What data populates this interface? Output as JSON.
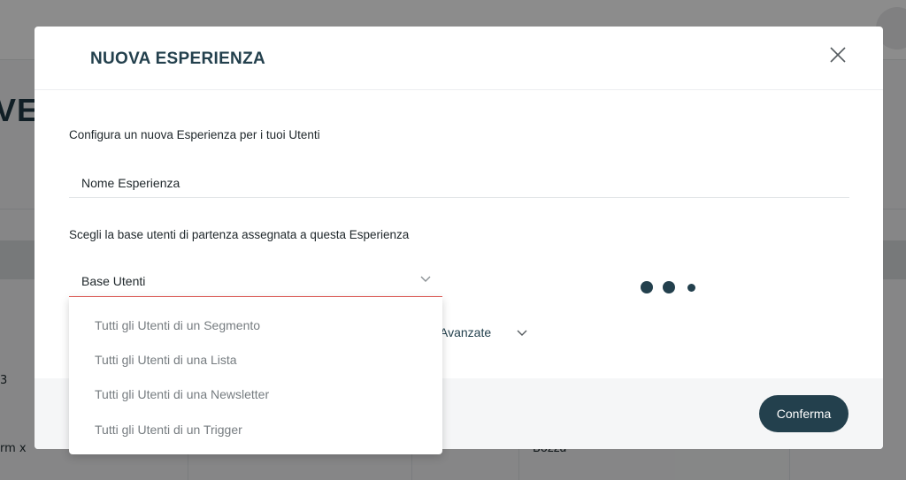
{
  "background": {
    "title_fragment": "VE",
    "cell_number": "3",
    "cell_form": "rm x",
    "cell_status": "Bozza"
  },
  "modal": {
    "title": "NUOVA ESPERIENZA",
    "close_icon": "close-icon",
    "intro_label": "Configura un nuova Esperienza per i tuoi Utenti",
    "name_placeholder": "Nome Esperienza",
    "base_label": "Scegli la base utenti di partenza assegnata a questa Esperienza",
    "base_select_value": "Base Utenti",
    "advanced_label": "Avanzate",
    "confirm_label": "Conferma"
  },
  "dropdown": {
    "options": [
      "Tutti gli Utenti di un Segmento",
      "Tutti gli Utenti di una Lista",
      "Tutti gli Utenti di una Newsletter",
      "Tutti gli Utenti di un Trigger"
    ]
  },
  "colors": {
    "accent": "#23404d",
    "select_underline": "#e3605a"
  }
}
